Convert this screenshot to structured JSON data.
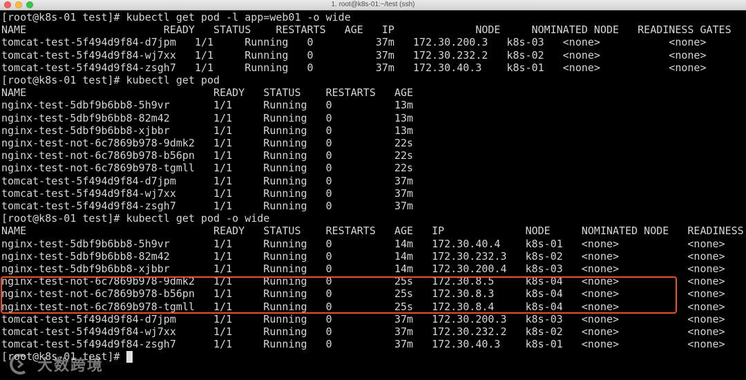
{
  "window": {
    "title": "1. root@k8s-01:~/test (ssh)"
  },
  "terminal": {
    "lines": [
      "[root@k8s-01 test]# kubectl get pod -l app=web01 -o wide",
      "NAME                      READY   STATUS    RESTARTS   AGE   IP             NODE     NOMINATED NODE   READINESS GATES",
      "tomcat-test-5f494d9f84-d7jpm   1/1     Running   0          37m   172.30.200.3   k8s-03   <none>           <none>",
      "tomcat-test-5f494d9f84-wj7xx   1/1     Running   0          37m   172.30.232.2   k8s-02   <none>           <none>",
      "tomcat-test-5f494d9f84-zsgh7   1/1     Running   0          37m   172.30.40.3    k8s-01   <none>           <none>",
      "[root@k8s-01 test]# kubectl get pod",
      "NAME                              READY   STATUS    RESTARTS   AGE",
      "nginx-test-5dbf9b6bb8-5h9vr       1/1     Running   0          13m",
      "nginx-test-5dbf9b6bb8-82m42       1/1     Running   0          13m",
      "nginx-test-5dbf9b6bb8-xjbbr       1/1     Running   0          13m",
      "nginx-test-not-6c7869b978-9dmk2   1/1     Running   0          22s",
      "nginx-test-not-6c7869b978-b56pn   1/1     Running   0          22s",
      "nginx-test-not-6c7869b978-tgmll   1/1     Running   0          22s",
      "tomcat-test-5f494d9f84-d7jpm      1/1     Running   0          37m",
      "tomcat-test-5f494d9f84-wj7xx      1/1     Running   0          37m",
      "tomcat-test-5f494d9f84-zsgh7      1/1     Running   0          37m",
      "[root@k8s-01 test]# kubectl get pod -o wide",
      "NAME                              READY   STATUS    RESTARTS   AGE   IP             NODE     NOMINATED NODE   READINESS GATES",
      "nginx-test-5dbf9b6bb8-5h9vr       1/1     Running   0          14m   172.30.40.4    k8s-01   <none>           <none>",
      "nginx-test-5dbf9b6bb8-82m42       1/1     Running   0          14m   172.30.232.3   k8s-02   <none>           <none>",
      "nginx-test-5dbf9b6bb8-xjbbr       1/1     Running   0          14m   172.30.200.4   k8s-03   <none>           <none>",
      "nginx-test-not-6c7869b978-9dmk2   1/1     Running   0          25s   172.30.8.5     k8s-04   <none>           <none>",
      "nginx-test-not-6c7869b978-b56pn   1/1     Running   0          25s   172.30.8.3     k8s-04   <none>           <none>",
      "nginx-test-not-6c7869b978-tgmll   1/1     Running   0          25s   172.30.8.4     k8s-04   <none>           <none>",
      "tomcat-test-5f494d9f84-d7jpm      1/1     Running   0          37m   172.30.200.3   k8s-03   <none>           <none>",
      "tomcat-test-5f494d9f84-wj7xx      1/1     Running   0          37m   172.30.232.2   k8s-02   <none>           <none>",
      "tomcat-test-5f494d9f84-zsgh7      1/1     Running   0          37m   172.30.40.3    k8s-01   <none>           <none>"
    ],
    "prompt": "[root@k8s-01 test]# "
  },
  "watermark": {
    "text": "大数跨境"
  },
  "colors": {
    "background": "#000000",
    "foreground": "#d6d6d6",
    "highlight": "#e8512a"
  }
}
